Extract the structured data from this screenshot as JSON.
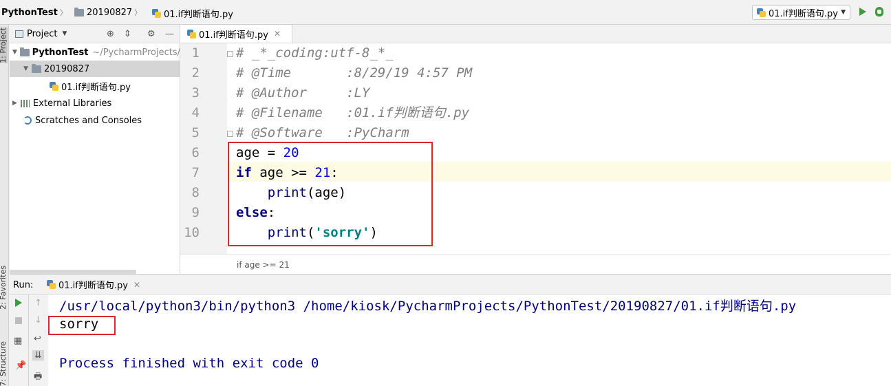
{
  "navbar": {
    "project": "PythonTest",
    "folder": "20190827",
    "file": "01.if判断语句.py",
    "run_config": "01.if判断语句.py"
  },
  "left_strip": {
    "project_tab": "1: Project",
    "favorites_tab": "2: Favorites",
    "structure_tab": "7: Structure"
  },
  "project_panel": {
    "title": "Project",
    "tree": [
      {
        "label": "PythonTest",
        "path": "~/PycharmProjects/"
      },
      {
        "label": "20190827"
      },
      {
        "label": "01.if判断语句.py"
      },
      {
        "label": "External Libraries"
      },
      {
        "label": "Scratches and Consoles"
      }
    ]
  },
  "editor": {
    "tab": "01.if判断语句.py",
    "line_numbers": [
      "1",
      "2",
      "3",
      "4",
      "5",
      "6",
      "7",
      "8",
      "9",
      "10"
    ],
    "lines": [
      "# _*_coding:utf-8_*_",
      "# @Time       :8/29/19 4:57 PM",
      "# @Author     :LY",
      "# @Filename   :01.if判断语句.py",
      "# @Software   :PyCharm"
    ],
    "code": {
      "l6_var": "age",
      "l6_eq": " = ",
      "l6_num": "20",
      "l7_if": "if",
      "l7_mid": " age >= ",
      "l7_num": "21",
      "l7_colon": ":",
      "l8_indent": "    ",
      "l8_print": "print",
      "l8_args": "(age)",
      "l9_else": "else",
      "l9_colon": ":",
      "l10_indent": "    ",
      "l10_print": "print",
      "l10_open": "(",
      "l10_str": "'sorry'",
      "l10_close": ")"
    },
    "breadcrumb": "if age >= 21"
  },
  "run": {
    "label": "Run:",
    "tab": "01.if判断语句.py",
    "output": [
      "/usr/local/python3/bin/python3 /home/kiosk/PycharmProjects/PythonTest/20190827/01.if判断语句.py",
      "sorry",
      "",
      "Process finished with exit code 0"
    ]
  },
  "colors": {
    "highlight_box": "#d9272e",
    "keyword": "#000080",
    "number": "#0000ff",
    "string": "#008080",
    "comment": "#808080",
    "run_green": "#3d9b3d"
  }
}
